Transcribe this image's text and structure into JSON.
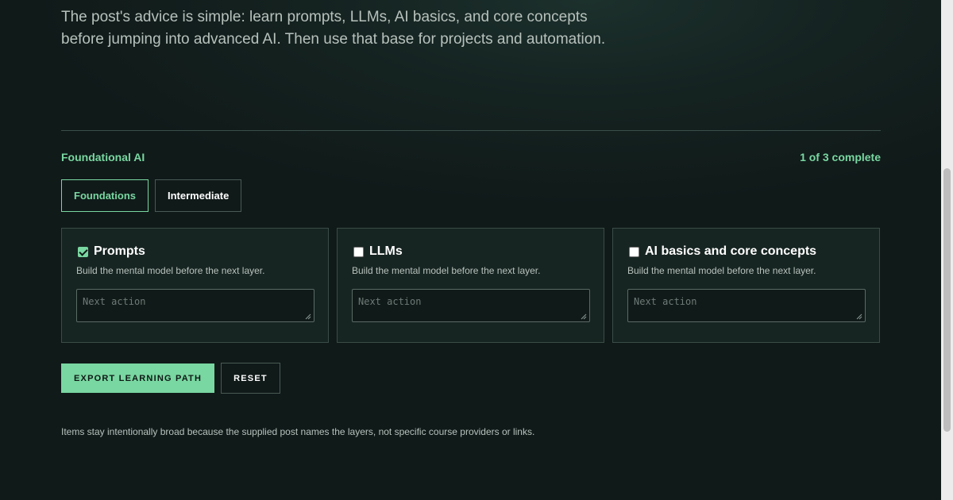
{
  "intro": {
    "line1": "The post's advice is simple: learn prompts, LLMs, AI basics, and core concepts",
    "line2": "before jumping into advanced AI. Then use that base for projects and automation."
  },
  "section": {
    "title": "Foundational AI",
    "progress": "1 of 3 complete"
  },
  "tabs": [
    {
      "label": "Foundations",
      "active": true
    },
    {
      "label": "Intermediate",
      "active": false
    }
  ],
  "cards": [
    {
      "title": "Prompts",
      "checked": true,
      "description": "Build the mental model before the next layer.",
      "placeholder": "Next action",
      "value": ""
    },
    {
      "title": "LLMs",
      "checked": false,
      "description": "Build the mental model before the next layer.",
      "placeholder": "Next action",
      "value": ""
    },
    {
      "title": "AI basics and core concepts",
      "checked": false,
      "description": "Build the mental model before the next layer.",
      "placeholder": "Next action",
      "value": ""
    }
  ],
  "actions": {
    "export_label": "EXPORT LEARNING PATH",
    "reset_label": "RESET"
  },
  "footnote": "Items stay intentionally broad because the supplied post names the layers, not specific course providers or links.",
  "colors": {
    "accent": "#79d7a1",
    "background": "#101a19",
    "card": "#172522"
  }
}
